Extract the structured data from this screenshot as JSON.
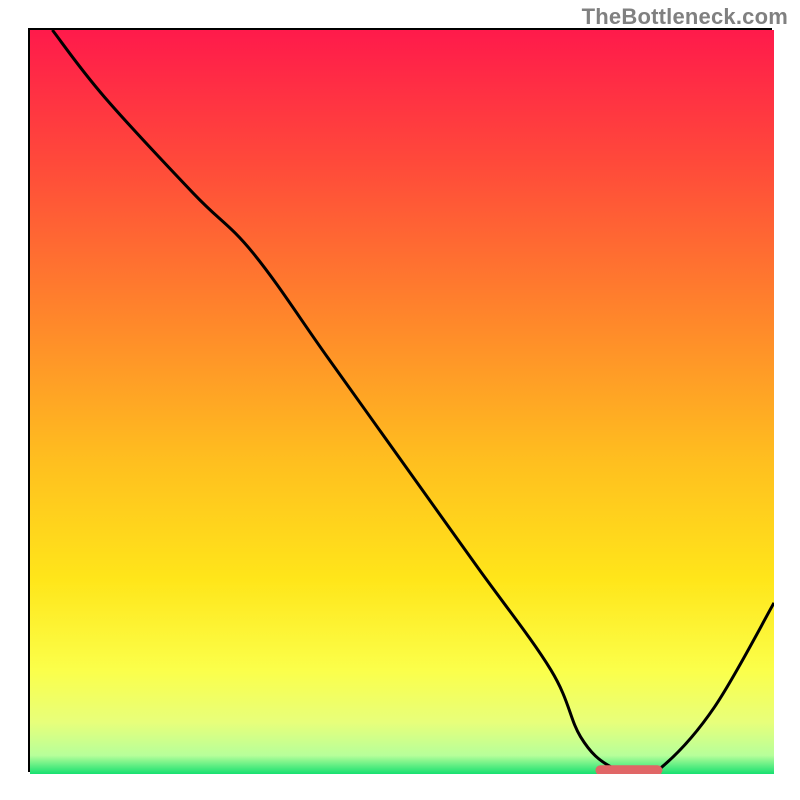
{
  "watermark": "TheBottleneck.com",
  "colors": {
    "border": "#000000",
    "line": "#000000",
    "marker": "#e06666",
    "gradient_stops": [
      {
        "offset": 0.0,
        "color": "#ff1a4b"
      },
      {
        "offset": 0.18,
        "color": "#ff4a3a"
      },
      {
        "offset": 0.4,
        "color": "#ff8a2a"
      },
      {
        "offset": 0.58,
        "color": "#ffbf1f"
      },
      {
        "offset": 0.74,
        "color": "#ffe61a"
      },
      {
        "offset": 0.86,
        "color": "#fbff4a"
      },
      {
        "offset": 0.93,
        "color": "#e8ff7a"
      },
      {
        "offset": 0.975,
        "color": "#b7ff9a"
      },
      {
        "offset": 1.0,
        "color": "#17e070"
      }
    ]
  },
  "chart_data": {
    "type": "line",
    "title": "",
    "xlabel": "",
    "ylabel": "",
    "xlim": [
      0,
      100
    ],
    "ylim": [
      0,
      100
    ],
    "grid": false,
    "x": [
      3,
      10,
      22,
      30,
      40,
      50,
      60,
      70,
      74,
      78,
      82,
      85,
      92,
      100
    ],
    "values": [
      100,
      91,
      78,
      70,
      56,
      42,
      28,
      14,
      5,
      1,
      0.5,
      1,
      9,
      23
    ],
    "optimum_marker": {
      "x_start": 76,
      "x_end": 85,
      "y": 0.5
    }
  }
}
